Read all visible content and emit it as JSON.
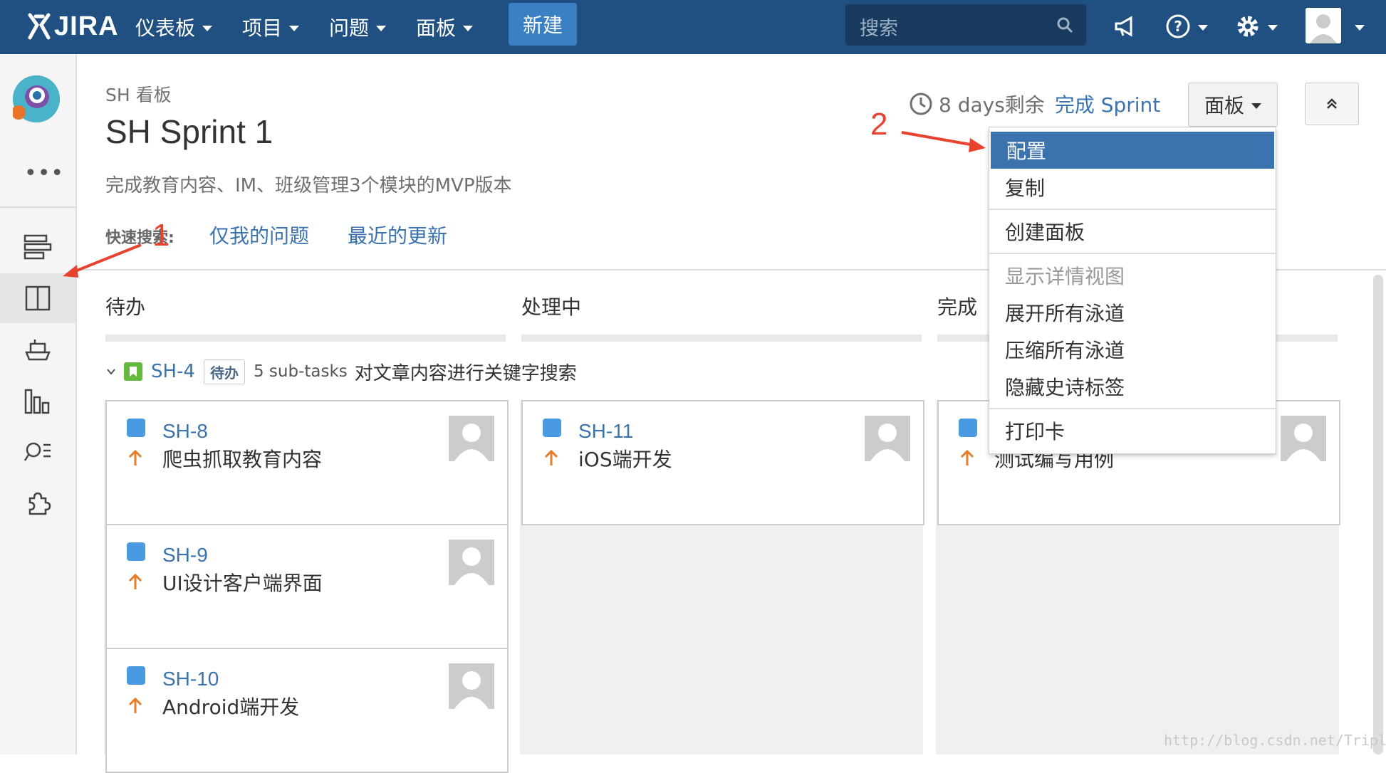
{
  "nav": {
    "logo": "JIRA",
    "menus": [
      "仪表板",
      "项目",
      "问题",
      "面板"
    ],
    "create": "新建",
    "search_placeholder": "搜索"
  },
  "header": {
    "breadcrumb": "SH 看板",
    "title": "SH Sprint 1",
    "goal": "完成教育内容、IM、班级管理3个模块的MVP版本",
    "quick_search_label": "快速搜索:",
    "quick_filters": [
      "仅我的问题",
      "最近的更新"
    ],
    "days_remaining": "8 days剩余",
    "complete_sprint": "完成 Sprint",
    "board_button": "面板"
  },
  "columns": [
    "待办",
    "处理中",
    "完成"
  ],
  "swimlane": {
    "key": "SH-4",
    "status": "待办",
    "subtasks": "5 sub-tasks",
    "summary": "对文章内容进行关键字搜索"
  },
  "cards": {
    "todo": [
      {
        "key": "SH-8",
        "summary": "爬虫抓取教育内容"
      },
      {
        "key": "SH-9",
        "summary": "UI设计客户端界面"
      },
      {
        "key": "SH-10",
        "summary": "Android端开发"
      }
    ],
    "in_progress": [
      {
        "key": "SH-11",
        "summary": "iOS端开发"
      }
    ],
    "done": [
      {
        "key": "",
        "summary": "测试编写用例"
      }
    ]
  },
  "dropdown": {
    "items": [
      "配置",
      "复制",
      "创建面板",
      "显示详情视图",
      "展开所有泳道",
      "压缩所有泳道",
      "隐藏史诗标签",
      "打印卡"
    ]
  },
  "annotations": {
    "one": "1",
    "two": "2"
  },
  "watermark": "http://blog.csdn.net/TripleS_",
  "colors": {
    "nav": "#205081",
    "accent": "#3b73af",
    "annotation": "#e8432f",
    "priority": "#e57c28"
  }
}
